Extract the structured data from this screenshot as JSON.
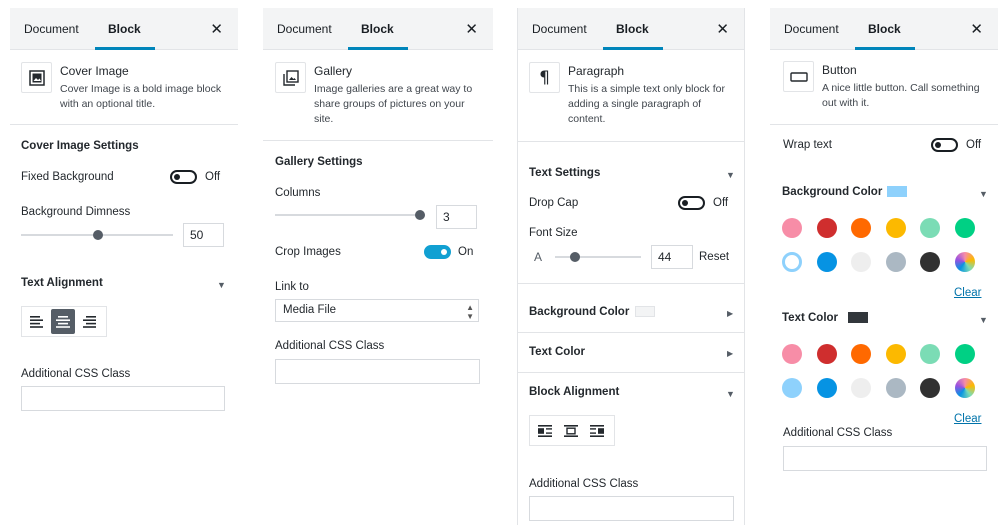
{
  "tabs": {
    "document": "Document",
    "block": "Block"
  },
  "panel1": {
    "block_title": "Cover Image",
    "block_desc_1": "Cover Image is a bold image block",
    "block_desc_2": "with an optional title.",
    "settings_title": "Cover Image Settings",
    "fixed_bg_label": "Fixed Background",
    "fixed_bg_state": "Off",
    "dimness_label": "Background Dimness",
    "dimness_value": "50",
    "dimness_level": 0.5,
    "text_align_title": "Text Alignment",
    "css_label": "Additional CSS Class"
  },
  "panel2": {
    "block_title": "Gallery",
    "block_desc_1": "Image galleries are a great way to",
    "block_desc_2": "share groups of pictures on your",
    "block_desc_3": "site.",
    "settings_title": "Gallery Settings",
    "columns_label": "Columns",
    "columns_value": "3",
    "crop_label": "Crop Images",
    "crop_state": "On",
    "link_label": "Link to",
    "link_value": "Media File",
    "css_label": "Additional CSS Class"
  },
  "panel3": {
    "block_title": "Paragraph",
    "block_desc_1": "This is a simple text only block for",
    "block_desc_2": "adding a single paragraph of",
    "block_desc_3": "content.",
    "text_settings": "Text Settings",
    "drop_cap_label": "Drop Cap",
    "drop_cap_state": "Off",
    "font_size_label": "Font Size",
    "font_letter": "A",
    "font_size_value": "44",
    "reset_label": "Reset",
    "bg_color_title": "Background Color",
    "text_color_title": "Text Color",
    "block_align_title": "Block Alignment",
    "css_label": "Additional CSS Class"
  },
  "panel4": {
    "block_title": "Button",
    "block_desc_1": "A nice little button. Call something",
    "block_desc_2": "out with it.",
    "wrap_label": "Wrap text",
    "wrap_state": "Off",
    "bg_color_title": "Background Color",
    "bg_selected": "#8ed1fc",
    "text_color_title": "Text Color",
    "text_selected": "#32373c",
    "clear_label": "Clear",
    "css_label": "Additional CSS Class",
    "palette": [
      "#f78da7",
      "#cf2e2e",
      "#ff6900",
      "#fcb900",
      "#7bdcb5",
      "#00d084",
      "#8ed1fc",
      "#0693e3",
      "#eeeeee",
      "#abb8c3",
      "#313131",
      "gradient"
    ]
  },
  "colors": {
    "accent": "#0085ba",
    "toggle_on": "#11a0d2",
    "link": "#0073aa"
  }
}
